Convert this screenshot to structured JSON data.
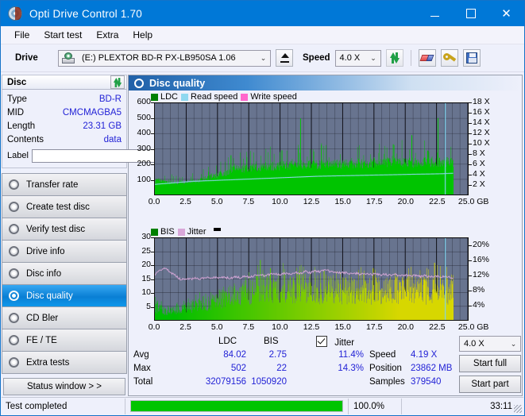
{
  "window": {
    "title": "Opti Drive Control 1.70",
    "icon": "disc-icon",
    "minimize": "─",
    "maximize": "□",
    "close": "✕"
  },
  "menu": {
    "items": [
      "File",
      "Start test",
      "Extra",
      "Help"
    ]
  },
  "toolbar": {
    "drive_label": "Drive",
    "drive_value": "(E:)   PLEXTOR BD-R  PX-LB950SA 1.06",
    "eject_title": "Eject",
    "speed_label": "Speed",
    "speed_value": "4.0 X",
    "icons": [
      "refresh-icon",
      "eraser-icon",
      "tool-icon",
      "save-icon"
    ],
    "chevron": "⌄"
  },
  "sidebar": {
    "disc_panel": {
      "title": "Disc",
      "refresh_icon": "refresh-icon",
      "rows": [
        {
          "key": "Type",
          "value": "BD-R"
        },
        {
          "key": "MID",
          "value": "CMCMAGBA5"
        },
        {
          "key": "Length",
          "value": "23.31 GB"
        },
        {
          "key": "Contents",
          "value": "data"
        }
      ],
      "label_key": "Label",
      "label_value": "",
      "disc_button_icon": "cd-icon"
    },
    "nav": [
      {
        "label": "Transfer rate",
        "selected": false
      },
      {
        "label": "Create test disc",
        "selected": false
      },
      {
        "label": "Verify test disc",
        "selected": false
      },
      {
        "label": "Drive info",
        "selected": false
      },
      {
        "label": "Disc info",
        "selected": false
      },
      {
        "label": "Disc quality",
        "selected": true
      },
      {
        "label": "CD Bler",
        "selected": false
      },
      {
        "label": "FE / TE",
        "selected": false
      },
      {
        "label": "Extra tests",
        "selected": false
      }
    ],
    "status_window_button": "Status window > >"
  },
  "main": {
    "header": "Disc quality",
    "header_icon": "disc-quality-icon"
  },
  "stats": {
    "col_ldc": "LDC",
    "col_bis": "BIS",
    "row_avg": "Avg",
    "row_max": "Max",
    "row_total": "Total",
    "avg_ldc": "84.02",
    "avg_bis": "2.75",
    "max_ldc": "502",
    "max_bis": "22",
    "total_ldc": "32079156",
    "total_bis": "1050920",
    "jitter_label": "Jitter",
    "jitter_checked": true,
    "jitter_avg": "11.4%",
    "jitter_max": "14.3%",
    "speed_label": "Speed",
    "speed_value": "4.19 X",
    "position_label": "Position",
    "position_value": "23862 MB",
    "samples_label": "Samples",
    "samples_value": "379540",
    "speed_select": "4.0 X",
    "chevron": "⌄",
    "start_full": "Start full",
    "start_part": "Start part"
  },
  "statusbar": {
    "text": "Test completed",
    "percent": "100.0%",
    "progress": 100,
    "time": "33:11"
  },
  "colors": {
    "accent": "#0078d7",
    "ldc_green": "#00c400",
    "read_speed": "#8fd8f0",
    "write_speed": "#ff66cc",
    "bis_green": "#00b000",
    "jitter_pink": "#d9a8d9",
    "plot_bg": "#68748f",
    "value_blue": "#2222d6"
  },
  "chart_data": [
    {
      "type": "area",
      "id": "ldc-chart",
      "title": "",
      "xlabel": "GB",
      "ylabel": "",
      "xlim": [
        0,
        25
      ],
      "ylim": [
        0,
        600
      ],
      "y2lim": [
        0,
        18
      ],
      "xticks": [
        "0.0",
        "2.5",
        "5.0",
        "7.5",
        "10.0",
        "12.5",
        "15.0",
        "17.5",
        "20.0",
        "22.5",
        "25.0 GB"
      ],
      "yticks": [
        "100",
        "200",
        "300",
        "400",
        "500",
        "600"
      ],
      "y2ticks": [
        "2 X",
        "4 X",
        "6 X",
        "8 X",
        "10 X",
        "12 X",
        "14 X",
        "16 X",
        "18 X"
      ],
      "legend": [
        {
          "name": "LDC",
          "color": "#008000"
        },
        {
          "name": "Read speed",
          "color": "#8fd8f0"
        },
        {
          "name": "Write speed",
          "color": "#ff66cc"
        }
      ],
      "grid": true,
      "data_end_gb": 23.85,
      "cursor_gb": 23.2,
      "series": [
        {
          "name": "LDC",
          "color": "#00c400",
          "x": [
            0.0,
            0.3,
            0.6,
            0.9,
            1.2,
            1.5,
            1.8,
            2.1,
            2.4,
            2.7,
            3.0,
            3.3,
            3.6,
            3.9,
            4.2,
            4.5,
            4.8,
            5.1,
            5.4,
            5.7,
            6.0,
            6.3,
            6.6,
            6.9,
            7.2,
            7.5,
            7.8,
            8.1,
            8.4,
            8.7,
            9.0,
            9.3,
            9.6,
            9.9,
            10.2,
            10.5,
            10.8,
            11.1,
            11.4,
            11.7,
            12.0,
            12.3,
            12.6,
            12.9,
            13.2,
            13.5,
            13.8,
            14.1,
            14.4,
            14.7,
            15.0,
            15.3,
            15.6,
            15.9,
            16.2,
            16.5,
            16.8,
            17.1,
            17.4,
            17.7,
            18.0,
            18.3,
            18.6,
            18.9,
            19.2,
            19.5,
            19.8,
            20.1,
            20.4,
            20.7,
            21.0,
            21.3,
            21.6,
            21.9,
            22.2,
            22.5,
            22.8,
            23.1,
            23.4,
            23.7
          ],
          "values": [
            95,
            100,
            92,
            88,
            85,
            82,
            84,
            86,
            90,
            92,
            95,
            96,
            100,
            108,
            118,
            130,
            135,
            140,
            150,
            155,
            175,
            180,
            178,
            182,
            185,
            188,
            190,
            192,
            195,
            198,
            196,
            200,
            198,
            202,
            205,
            203,
            206,
            204,
            208,
            206,
            210,
            208,
            212,
            210,
            214,
            212,
            215,
            213,
            216,
            214,
            218,
            216,
            219,
            217,
            220,
            218,
            221,
            219,
            222,
            220,
            223,
            221,
            224,
            222,
            225,
            223,
            226,
            224,
            227,
            225,
            228,
            226,
            229,
            227,
            230,
            228,
            231,
            229,
            232,
            230
          ],
          "peaks": [
            {
              "x": 6.05,
              "y": 258
            },
            {
              "x": 11.6,
              "y": 500
            },
            {
              "x": 19.0,
              "y": 330
            },
            {
              "x": 20.5,
              "y": 390
            },
            {
              "x": 22.6,
              "y": 502
            }
          ]
        },
        {
          "name": "Read speed",
          "color": "#8fd8f0",
          "x": [
            0.0,
            1.0,
            2.0,
            3.0,
            4.0,
            5.0,
            6.0,
            7.0,
            8.0,
            9.0,
            10.0,
            11.0,
            12.0,
            13.0,
            14.0,
            15.0,
            16.0,
            17.0,
            18.0,
            19.0,
            20.0,
            21.0,
            22.0,
            23.0,
            23.8
          ],
          "values": [
            2.0,
            2.2,
            2.4,
            2.6,
            2.7,
            2.8,
            2.9,
            3.0,
            3.1,
            3.2,
            3.3,
            3.4,
            3.5,
            3.6,
            3.65,
            3.7,
            3.75,
            3.8,
            3.85,
            3.9,
            3.95,
            4.0,
            4.05,
            4.1,
            4.19
          ]
        }
      ]
    },
    {
      "type": "area",
      "id": "bis-jitter-chart",
      "title": "",
      "xlabel": "GB",
      "ylabel": "",
      "xlim": [
        0,
        25
      ],
      "ylim": [
        0,
        30
      ],
      "y2lim": [
        0,
        22
      ],
      "xticks": [
        "0.0",
        "2.5",
        "5.0",
        "7.5",
        "10.0",
        "12.5",
        "15.0",
        "17.5",
        "20.0",
        "22.5",
        "25.0 GB"
      ],
      "yticks": [
        "5",
        "10",
        "15",
        "20",
        "25",
        "30"
      ],
      "y2ticks": [
        "4%",
        "8%",
        "12%",
        "16%",
        "20%"
      ],
      "legend": [
        {
          "name": "BIS",
          "color": "#008000"
        },
        {
          "name": "Jitter",
          "color": "#d9a8d9"
        }
      ],
      "grid": true,
      "data_end_gb": 23.85,
      "cursor_gb": 23.2,
      "series": [
        {
          "name": "BIS",
          "color": "#00b000",
          "x": [
            0.0,
            0.5,
            1.0,
            1.5,
            2.0,
            2.5,
            3.0,
            3.5,
            4.0,
            4.5,
            5.0,
            5.5,
            6.0,
            6.5,
            7.0,
            7.5,
            8.0,
            8.5,
            9.0,
            9.5,
            10.0,
            10.5,
            11.0,
            11.5,
            12.0,
            12.5,
            13.0,
            13.5,
            14.0,
            14.5,
            15.0,
            15.5,
            16.0,
            16.5,
            17.0,
            17.5,
            18.0,
            18.5,
            19.0,
            19.5,
            20.0,
            20.5,
            21.0,
            21.5,
            22.0,
            22.5,
            23.0,
            23.5
          ],
          "values": [
            5.5,
            4.5,
            3.5,
            4.0,
            4.5,
            5.0,
            5.5,
            6.5,
            7.0,
            7.5,
            8.5,
            9.0,
            10.0,
            10.5,
            11.0,
            12.0,
            12.5,
            13.0,
            13.5,
            13.0,
            13.5,
            14.0,
            13.5,
            14.0,
            13.0,
            13.5,
            12.5,
            13.0,
            12.5,
            13.5,
            12.0,
            13.0,
            12.0,
            12.5,
            12.0,
            12.5,
            11.5,
            12.5,
            12.0,
            12.5,
            12.0,
            13.0,
            12.0,
            12.5,
            12.0,
            13.0,
            12.5,
            12.0
          ],
          "peaks": [
            {
              "x": 8.4,
              "y": 22
            },
            {
              "x": 9.2,
              "y": 19
            },
            {
              "x": 13.5,
              "y": 18
            },
            {
              "x": 17.4,
              "y": 19
            },
            {
              "x": 22.3,
              "y": 21
            }
          ]
        },
        {
          "name": "Jitter",
          "color": "#d9a8d9",
          "x": [
            0.0,
            0.4,
            0.8,
            1.2,
            1.6,
            2.0,
            2.4,
            2.8,
            3.2,
            3.6,
            4.0,
            4.4,
            4.8,
            5.2,
            5.6,
            6.0,
            6.4,
            6.8,
            7.2,
            7.6,
            8.0,
            8.4,
            8.8,
            9.2,
            9.6,
            10.0,
            10.4,
            10.8,
            11.2,
            11.6,
            12.0,
            12.4,
            12.8,
            13.2,
            13.6,
            14.0,
            14.4,
            14.8,
            15.2,
            15.6,
            16.0,
            16.4,
            16.8,
            17.2,
            17.6,
            18.0,
            18.4,
            18.8,
            19.2,
            19.6,
            20.0,
            20.4,
            20.8,
            21.2,
            21.6,
            22.0,
            22.4,
            22.8,
            23.2,
            23.6
          ],
          "values": [
            12.0,
            13.5,
            14.1,
            12.9,
            12.1,
            11.0,
            10.8,
            11.0,
            11.2,
            11.0,
            11.4,
            11.2,
            11.4,
            11.3,
            11.5,
            11.2,
            11.6,
            11.4,
            11.7,
            11.5,
            11.9,
            12.2,
            11.8,
            12.3,
            12.4,
            12.1,
            12.6,
            12.3,
            12.8,
            12.5,
            13.1,
            12.7,
            13.3,
            12.9,
            13.5,
            13.0,
            12.9,
            12.6,
            12.7,
            12.4,
            12.6,
            12.3,
            12.5,
            12.2,
            12.4,
            12.1,
            12.3,
            12.0,
            12.2,
            11.9,
            12.1,
            11.8,
            12.0,
            11.7,
            11.9,
            11.6,
            11.8,
            11.5,
            11.7,
            11.4
          ]
        }
      ]
    }
  ]
}
